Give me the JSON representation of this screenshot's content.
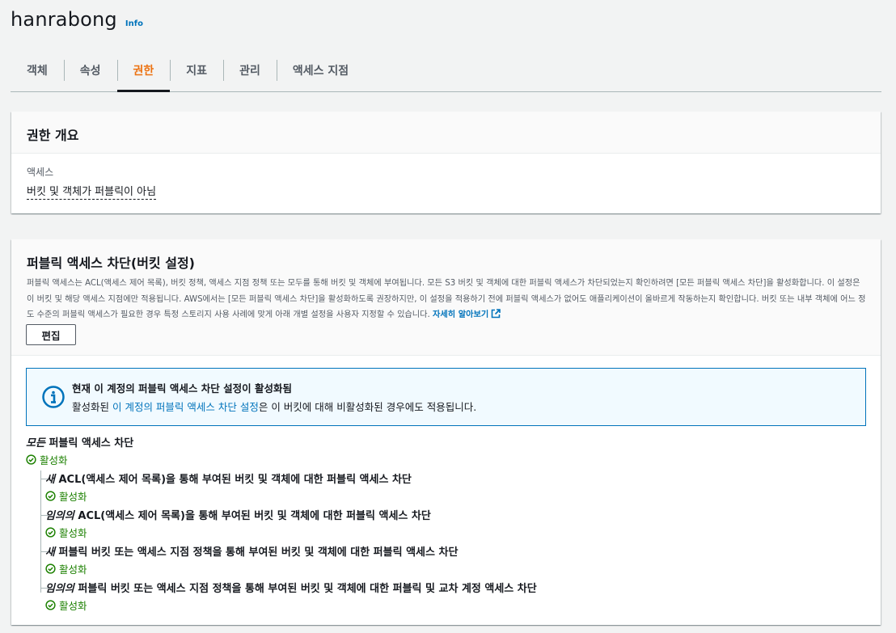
{
  "header": {
    "title": "hanrabong",
    "info": "Info"
  },
  "tabs": [
    "객체",
    "속성",
    "권한",
    "지표",
    "관리",
    "액세스 지점"
  ],
  "overview": {
    "title": "권한 개요",
    "access_label": "액세스",
    "access_value": "버킷 및 객체가 퍼블릭이 아님"
  },
  "block_public": {
    "title": "퍼블릭 액세스 차단(버킷 설정)",
    "description": "퍼블릭 액세스는 ACL(액세스 제어 목록), 버킷 정책, 액세스 지점 정책 또는 모두를 통해 버킷 및 객체에 부여됩니다. 모든 S3 버킷 및 객체에 대한 퍼블릭 액세스가 차단되었는지 확인하려면 [모든 퍼블릭 액세스 차단]을 활성화합니다. 이 설정은 이 버킷 및 해당 액세스 지점에만 적용됩니다. AWS에서는 [모든 퍼블릭 액세스 차단]을 활성화하도록 권장하지만, 이 설정을 적용하기 전에 퍼블릭 액세스가 없어도 애플리케이션이 올바르게 작동하는지 확인합니다. 버킷 또는 내부 객체에 어느 정도 수준의 퍼블릭 액세스가 필요한 경우 특정 스토리지 사용 사례에 맞게 아래 개별 설정을 사용자 지정할 수 있습니다.",
    "learn_more": "자세히 알아보기",
    "edit_label": "편집"
  },
  "alert": {
    "title": "현재 이 계정의 퍼블릭 액세스 차단 설정이 활성화됨",
    "text_prefix": "활성화된 ",
    "text_link": "이 계정의 퍼블릭 액세스 차단 설정",
    "text_suffix": "은 이 버킷에 대해 비활성화된 경우에도 적용됩니다."
  },
  "main_setting": {
    "emphasis": "모든",
    "title_rest": " 퍼블릭 액세스 차단",
    "status": "활성화"
  },
  "sub_settings": [
    {
      "emphasis": "새",
      "title_rest": " ACL(액세스 제어 목록)을 통해 부여된 버킷 및 객체에 대한 퍼블릭 액세스 차단",
      "status": "활성화"
    },
    {
      "emphasis": "임의의",
      "title_rest": " ACL(액세스 제어 목록)을 통해 부여된 버킷 및 객체에 대한 퍼블릭 액세스 차단",
      "status": "활성화"
    },
    {
      "emphasis": "새",
      "title_rest": " 퍼블릭 버킷 또는 액세스 지점 정책을 통해 부여된 버킷 및 객체에 대한 퍼블릭 액세스 차단",
      "status": "활성화"
    },
    {
      "emphasis": "임의의",
      "title_rest": " 퍼블릭 버킷 또는 액세스 지점 정책을 통해 부여된 버킷 및 객체에 대한 퍼블릭 및 교차 계정 액세스 차단",
      "status": "활성화"
    }
  ],
  "colors": {
    "accent": "#ec7211",
    "link": "#0073bb",
    "success": "#1d8102",
    "info_border": "#0073bb"
  },
  "active_tab_index": 2
}
